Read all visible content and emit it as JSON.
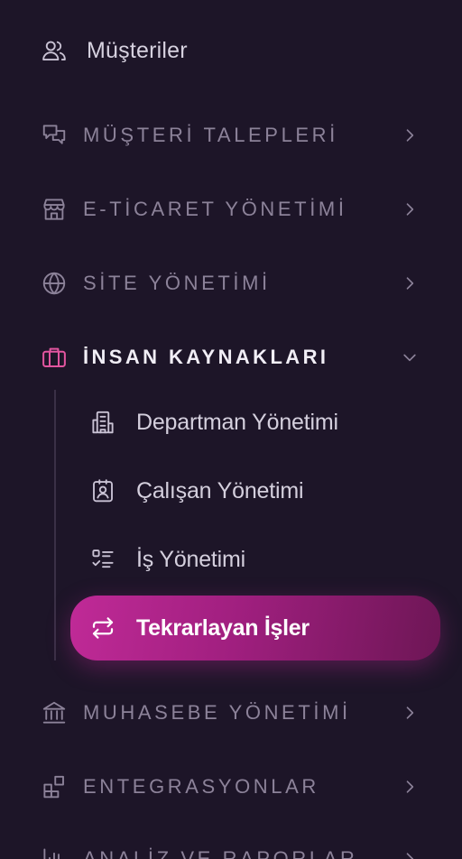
{
  "colors": {
    "background": "#1d1528",
    "accent": "#c02a97",
    "active_icon": "#e2559f",
    "muted_text": "#8c8299"
  },
  "menu": {
    "customers": {
      "label": "Müşteriler",
      "icon": "users-icon"
    },
    "requests": {
      "label": "MÜŞTERİ TALEPLERİ",
      "icon": "chat-bubbles-icon"
    },
    "ecommerce": {
      "label": "E-TİCARET YÖNETİMİ",
      "icon": "store-icon"
    },
    "site": {
      "label": "SİTE YÖNETİMİ",
      "icon": "globe-icon"
    },
    "hr": {
      "label": "İNSAN KAYNAKLARI",
      "icon": "briefcase-icon",
      "expanded": true,
      "items": [
        {
          "label": "Departman Yönetimi",
          "icon": "building-icon"
        },
        {
          "label": "Çalışan Yönetimi",
          "icon": "id-badge-icon"
        },
        {
          "label": "İş Yönetimi",
          "icon": "checklist-icon"
        },
        {
          "label": "Tekrarlayan İşler",
          "icon": "repeat-icon",
          "active": true
        }
      ]
    },
    "accounting": {
      "label": "MUHASEBE YÖNETİMİ",
      "icon": "bank-icon"
    },
    "integrations": {
      "label": "ENTEGRASYONLAR",
      "icon": "blocks-icon"
    },
    "analytics": {
      "label": "ANALİZ VE RAPORLAR",
      "icon": "bar-chart-icon"
    }
  }
}
